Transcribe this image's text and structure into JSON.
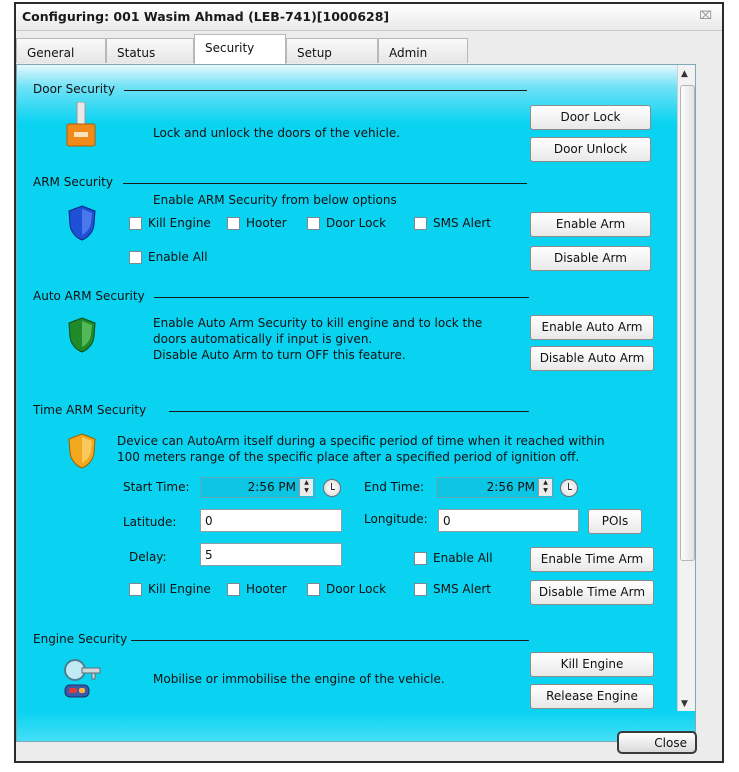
{
  "window": {
    "title": "Configuring: 001 Wasim Ahmad (LEB-741)[1000628]",
    "close_glyph": "⌧"
  },
  "tabs": [
    {
      "label": "General",
      "active": false
    },
    {
      "label": "Status",
      "active": false
    },
    {
      "label": "Security",
      "active": true
    },
    {
      "label": "Setup",
      "active": false
    },
    {
      "label": "Admin",
      "active": false
    }
  ],
  "door_security": {
    "title": "Door Security",
    "icon": "door-lock-icon",
    "description": "Lock and unlock the doors of the vehicle.",
    "lock_button": "Door Lock",
    "unlock_button": "Door Unlock"
  },
  "arm_security": {
    "title": "ARM Security",
    "icon": "blue-shield-icon",
    "description": "Enable ARM Security from below options",
    "options": {
      "kill_engine": "Kill Engine",
      "hooter": "Hooter",
      "door_lock": "Door Lock",
      "sms_alert": "SMS Alert",
      "enable_all": "Enable All"
    },
    "enable_button": "Enable Arm",
    "disable_button": "Disable Arm"
  },
  "auto_arm_security": {
    "title": "Auto ARM Security",
    "icon": "green-shield-icon",
    "description_line1": "Enable Auto Arm Security to kill engine and to lock the",
    "description_line2": "doors automatically if input is given.",
    "description_line3": "Disable Auto Arm to turn OFF this feature.",
    "enable_button": "Enable Auto Arm",
    "disable_button": "Disable Auto Arm"
  },
  "time_arm_security": {
    "title": "Time ARM Security",
    "icon": "gold-shield-icon",
    "description_line1": "Device can AutoArm itself during a specific period of time when it reached within",
    "description_line2": "100 meters range of the specific place after a specified period of ignition off.",
    "start_time_label": "Start Time:",
    "start_time_value": "2:56 PM",
    "end_time_label": "End Time:",
    "end_time_value": "2:56 PM",
    "latitude_label": "Latitude:",
    "latitude_value": "0",
    "longitude_label": "Longitude:",
    "longitude_value": "0",
    "pois_button": "POIs",
    "delay_label": "Delay:",
    "delay_value": "5",
    "options": {
      "enable_all": "Enable All",
      "kill_engine": "Kill Engine",
      "hooter": "Hooter",
      "door_lock": "Door Lock",
      "sms_alert": "SMS Alert"
    },
    "enable_button": "Enable Time Arm",
    "disable_button": "Disable Time Arm"
  },
  "engine_security": {
    "title": "Engine Security",
    "icon": "engine-key-icon",
    "description": "Mobilise or immobilise the engine of the vehicle.",
    "kill_button": "Kill Engine",
    "release_button": "Release Engine"
  },
  "footer": {
    "close_button": "Close"
  },
  "colors": {
    "panel_cyan": "#0ad3f2",
    "title_bg": "#ffffff"
  }
}
